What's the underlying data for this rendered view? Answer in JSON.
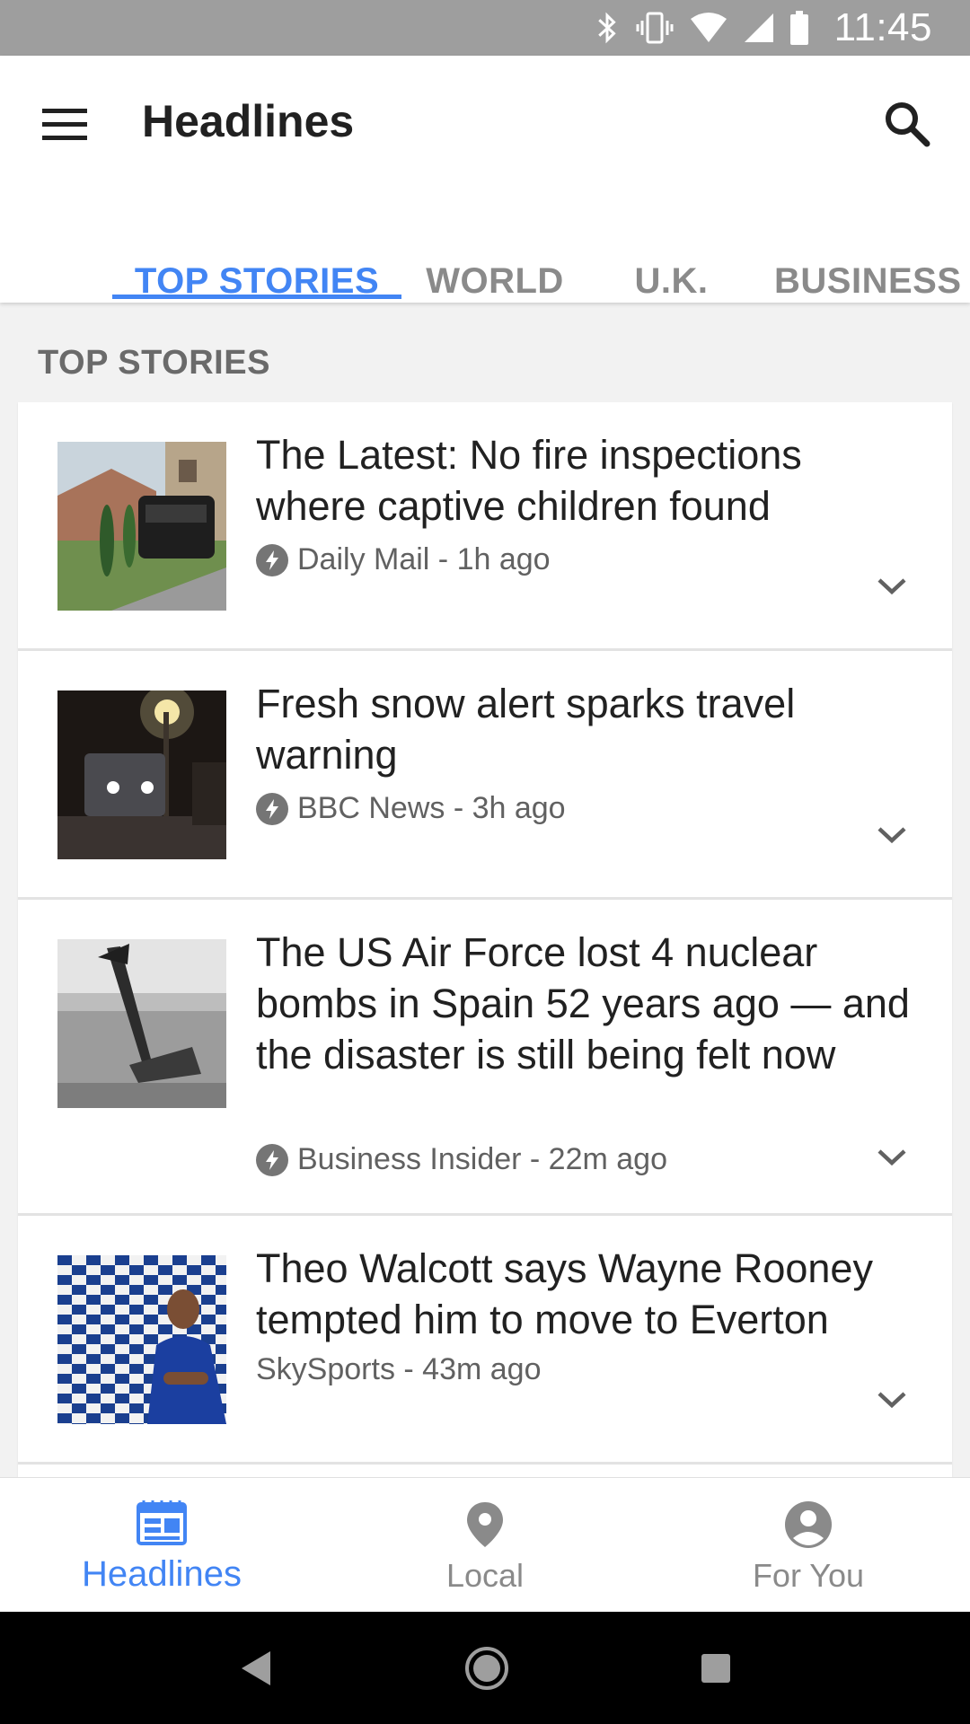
{
  "status_bar": {
    "time": "11:45",
    "icons": [
      "bluetooth-icon",
      "vibrate-icon",
      "wifi-icon",
      "signal-icon",
      "battery-icon"
    ]
  },
  "app_bar": {
    "title": "Headlines",
    "menu_icon": "menu-icon",
    "search_icon": "search-icon"
  },
  "tabs": [
    {
      "label": "TOP STORIES",
      "active": true
    },
    {
      "label": "WORLD",
      "active": false
    },
    {
      "label": "U.K.",
      "active": false
    },
    {
      "label": "BUSINESS",
      "active": false
    }
  ],
  "section": {
    "title": "TOP STORIES"
  },
  "articles": [
    {
      "headline": "The Latest: No fire inspections where captive children found",
      "source": "Daily Mail - 1h ago",
      "amp": true
    },
    {
      "headline": "Fresh snow alert sparks travel warning",
      "source": "BBC News - 3h ago",
      "amp": true
    },
    {
      "headline": "The US Air Force lost 4 nuclear bombs in Spain 52 years ago — and the disaster is still being felt now",
      "source": "Business Insider - 22m ago",
      "amp": true
    },
    {
      "headline": "Theo Walcott says Wayne Rooney tempted him to move to Everton",
      "source": "SkySports - 43m ago",
      "amp": false
    }
  ],
  "bottom_nav": [
    {
      "label": "Headlines",
      "icon": "newspaper-icon",
      "active": true
    },
    {
      "label": "Local",
      "icon": "location-pin-icon",
      "active": false
    },
    {
      "label": "For You",
      "icon": "account-icon",
      "active": false
    }
  ],
  "system_nav": [
    "back-icon",
    "home-icon",
    "recents-icon"
  ],
  "colors": {
    "accent": "#4285f4",
    "status_bar": "#9e9e9e",
    "background": "#f2f2f2"
  }
}
